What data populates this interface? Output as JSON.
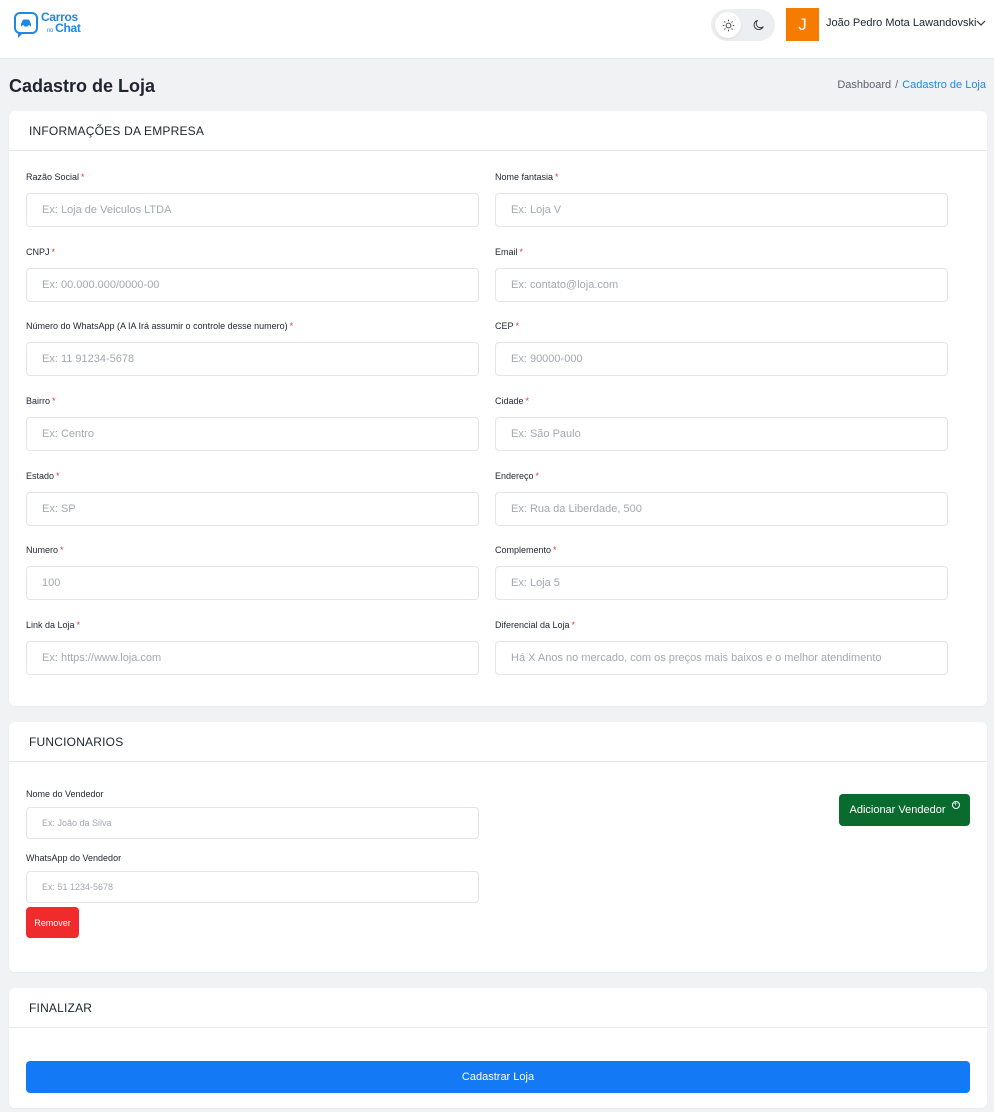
{
  "header": {
    "logo_line1": "Carros",
    "logo_small": "no",
    "logo_line2": "Chat",
    "user_initial": "J",
    "user_name": "João Pedro Mota Lawandovski"
  },
  "page": {
    "title": "Cadastro de Loja",
    "breadcrumb": {
      "home": "Dashboard",
      "separator": "/",
      "current": "Cadastro de Loja"
    }
  },
  "empresa": {
    "title": "INFORMAÇÕES DA EMPRESA",
    "fields": [
      {
        "label": "Razão Social",
        "placeholder": "Ex: Loja de Veiculos LTDA"
      },
      {
        "label": "Nome fantasia",
        "placeholder": "Ex: Loja V"
      },
      {
        "label": "CNPJ",
        "placeholder": "Ex: 00.000.000/0000-00"
      },
      {
        "label": "Email",
        "placeholder": "Ex: contato@loja.com"
      },
      {
        "label": "Número do WhatsApp (A IA Irá assumir o controle desse numero)",
        "placeholder": "Ex: 11 91234-5678"
      },
      {
        "label": "CEP",
        "placeholder": "Ex: 90000-000"
      },
      {
        "label": "Bairro",
        "placeholder": "Ex: Centro"
      },
      {
        "label": "Cidade",
        "placeholder": "Ex: São Paulo"
      },
      {
        "label": "Estado",
        "placeholder": "Ex: SP"
      },
      {
        "label": "Endereço",
        "placeholder": "Ex: Rua da Liberdade, 500"
      },
      {
        "label": "Numero",
        "placeholder": "100"
      },
      {
        "label": "Complemento",
        "placeholder": "Ex: Loja 5"
      },
      {
        "label": "Link da Loja",
        "placeholder": "Ex: https://www.loja.com"
      },
      {
        "label": "Diferencial da Loja",
        "placeholder": "Há X Anos no mercado, com os preços mais baixos e o melhor atendimento"
      }
    ],
    "required_mark": "*"
  },
  "funcionarios": {
    "title": "FUNCIONARIOS",
    "vendedor_label": "Nome do Vendedor",
    "vendedor_placeholder": "Ex: João da Silva",
    "whatsapp_label": "WhatsApp do Vendedor",
    "whatsapp_placeholder": "Ex: 51 1234-5678",
    "remove_label": "Remover",
    "add_label": "Adicionar Vendedor"
  },
  "finalizar": {
    "title": "FINALIZAR",
    "submit_label": "Cadastrar Loja"
  },
  "colors": {
    "primary": "#1479f5",
    "success": "#0a6b2f",
    "danger": "#ef2b2b",
    "avatar": "#f57c00",
    "brand": "#1e88e5"
  }
}
